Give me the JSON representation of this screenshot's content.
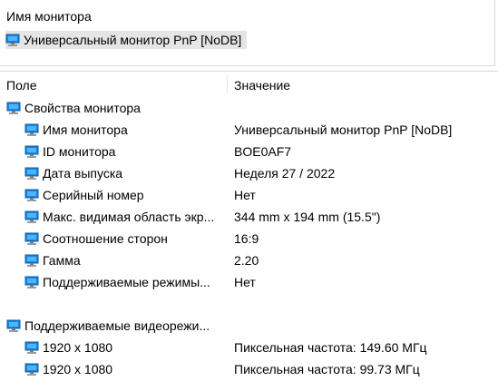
{
  "device_panel": {
    "header": "Имя монитора",
    "selected_device": "Универсальный монитор PnP [NoDB]"
  },
  "details": {
    "columns": {
      "field": "Поле",
      "value": "Значение"
    },
    "monitor_props": {
      "label": "Свойства монитора",
      "items": [
        {
          "field": "Имя монитора",
          "value": "Универсальный монитор PnP [NoDB]"
        },
        {
          "field": "ID монитора",
          "value": "BOE0AF7"
        },
        {
          "field": "Дата выпуска",
          "value": "Неделя 27 / 2022"
        },
        {
          "field": "Серийный номер",
          "value": "Нет"
        },
        {
          "field": "Макс. видимая область экр...",
          "value": "344 mm x 194 mm (15.5\")"
        },
        {
          "field": "Соотношение сторон",
          "value": "16:9"
        },
        {
          "field": "Гамма",
          "value": "2.20"
        },
        {
          "field": "Поддерживаемые режимы...",
          "value": "Нет"
        }
      ]
    },
    "video_modes": {
      "label": "Поддерживаемые видеорежи...",
      "items": [
        {
          "field": "1920 x 1080",
          "value": "Пиксельная частота: 149.60 МГц"
        },
        {
          "field": "1920 x 1080",
          "value": "Пиксельная частота: 99.73 МГц"
        }
      ]
    }
  },
  "colors": {
    "selection_bg": "#e5e5e5",
    "divider": "#d9d9d9",
    "icon_screen": "#1a86d8",
    "icon_screen_dark": "#0a5ca8"
  },
  "icons": {
    "monitor": "monitor-icon"
  }
}
